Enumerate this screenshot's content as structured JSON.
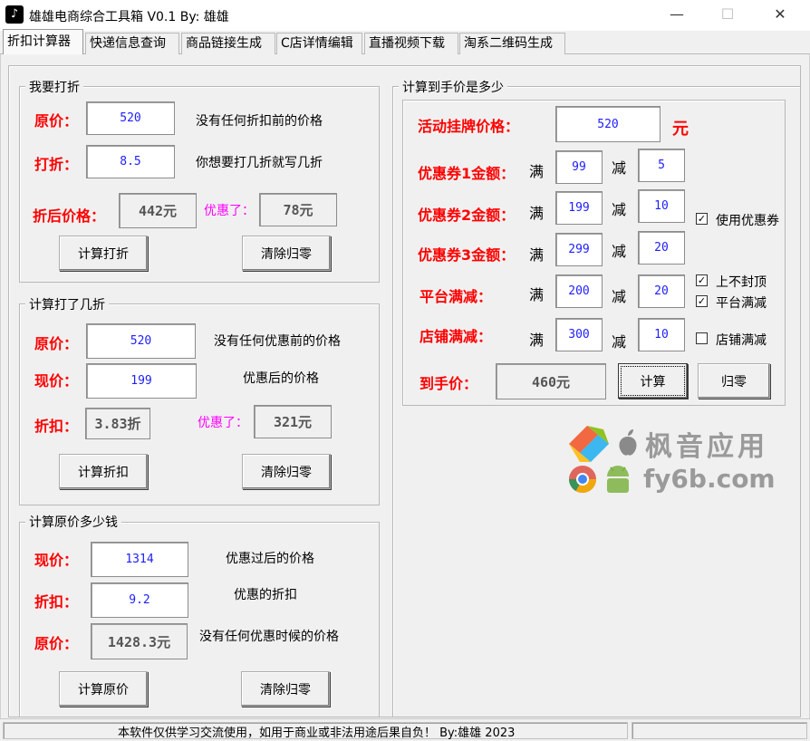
{
  "window": {
    "title": "雄雄电商综合工具箱 V0.1  By: 雄雄",
    "minimize": "—",
    "maximize": "☐",
    "close": "✕"
  },
  "tabs": [
    "折扣计算器",
    "快递信息查询",
    "商品链接生成",
    "C店详情编辑",
    "直播视频下载",
    "淘系二维码生成"
  ],
  "discount": {
    "legend": "我要打折",
    "orig_label": "原价：",
    "orig_value": "520",
    "orig_hint": "没有任何折扣前的价格",
    "rate_label": "打折：",
    "rate_value": "8.5",
    "rate_hint": "你想要打几折就写几折",
    "after_label": "折后价格：",
    "after_value": "442元",
    "saved_label": "优惠了：",
    "saved_value": "78元",
    "calc_button": "计算打折",
    "clear_button": "清除归零"
  },
  "whatrate": {
    "legend": "计算打了几折",
    "orig_label": "原价：",
    "orig_value": "520",
    "orig_hint": "没有任何优惠前的价格",
    "now_label": "现价：",
    "now_value": "199",
    "now_hint": "优惠后的价格",
    "rate_label": "折扣：",
    "rate_value": "3.83折",
    "saved_label": "优惠了：",
    "saved_value": "321元",
    "calc_button": "计算折扣",
    "clear_button": "清除归零"
  },
  "origprice": {
    "legend": "计算原价多少钱",
    "now_label": "现价：",
    "now_value": "1314",
    "now_hint": "优惠过后的价格",
    "rate_label": "折扣：",
    "rate_value": "9.2",
    "rate_hint": "优惠的折扣",
    "orig_label": "原价：",
    "orig_value": "1428.3元",
    "orig_hint": "没有任何优惠时候的价格",
    "calc_button": "计算原价",
    "clear_button": "清除归零"
  },
  "final": {
    "legend": "计算到手价是多少",
    "list_label": "活动挂牌价格：",
    "list_value": "520",
    "unit": "元",
    "full": "满",
    "minus": "减",
    "coupon1_label": "优惠券1金额：",
    "coupon1_full": "99",
    "coupon1_minus": "5",
    "coupon2_label": "优惠券2金额：",
    "coupon2_full": "199",
    "coupon2_minus": "10",
    "coupon3_label": "优惠券3金额：",
    "coupon3_full": "299",
    "coupon3_minus": "20",
    "platform_label": "平台满减：",
    "platform_full": "200",
    "platform_minus": "20",
    "shop_label": "店铺满减：",
    "shop_full": "300",
    "shop_minus": "10",
    "use_coupon": "使用优惠券",
    "no_cap": "上不封顶",
    "platform_check": "平台满减",
    "shop_check": "店铺满减",
    "check_mark": "✓",
    "result_label": "到手价：",
    "result_value": "460元",
    "calc_button": "计算",
    "clear_button": "归零"
  },
  "watermark": {
    "cn": "枫音应用",
    "url": "fy6b.com"
  },
  "status": {
    "text": "本软件仅供学习交流使用，如用于商业或非法用途后果自负！ By:雄雄  2023"
  }
}
